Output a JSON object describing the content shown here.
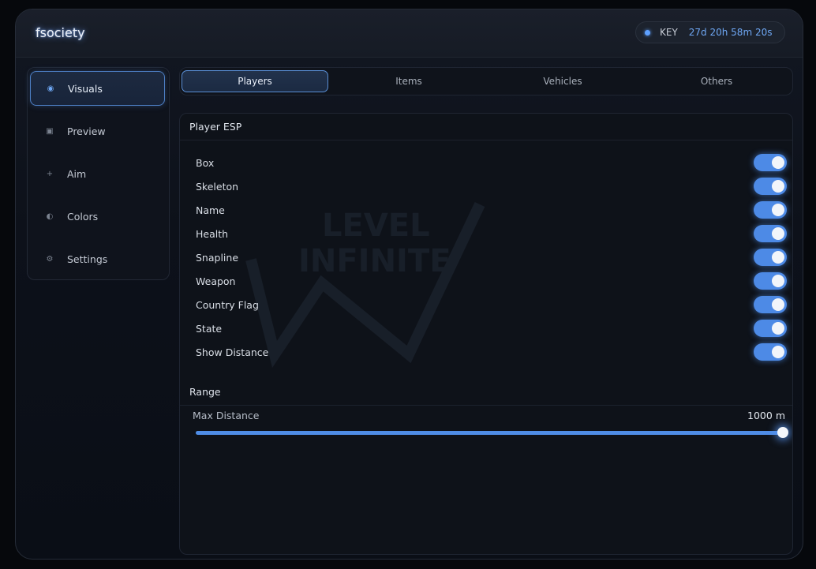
{
  "app": {
    "title": "fsociety"
  },
  "key": {
    "label": "KEY",
    "time": "27d 20h 58m 20s"
  },
  "sidebar": {
    "items": [
      {
        "label": "Visuals",
        "icon": "radio-dot-icon",
        "glyph": "◉",
        "active": true
      },
      {
        "label": "Preview",
        "icon": "square-icon",
        "glyph": "▣",
        "active": false
      },
      {
        "label": "Aim",
        "icon": "crosshair-icon",
        "glyph": "+",
        "active": false
      },
      {
        "label": "Colors",
        "icon": "half-circle-icon",
        "glyph": "◐",
        "active": false
      },
      {
        "label": "Settings",
        "icon": "gear-icon",
        "glyph": "⚙",
        "active": false
      }
    ]
  },
  "tabs": [
    {
      "label": "Players",
      "active": true
    },
    {
      "label": "Items",
      "active": false
    },
    {
      "label": "Vehicles",
      "active": false
    },
    {
      "label": "Others",
      "active": false
    }
  ],
  "player_esp": {
    "title": "Player ESP",
    "options": [
      {
        "label": "Box",
        "enabled": true
      },
      {
        "label": "Skeleton",
        "enabled": true
      },
      {
        "label": "Name",
        "enabled": true
      },
      {
        "label": "Health",
        "enabled": true
      },
      {
        "label": "Snapline",
        "enabled": true
      },
      {
        "label": "Weapon",
        "enabled": true
      },
      {
        "label": "Country Flag",
        "enabled": true
      },
      {
        "label": "State",
        "enabled": true
      },
      {
        "label": "Show Distance",
        "enabled": true
      }
    ]
  },
  "range": {
    "title": "Range",
    "max_distance_label": "Max Distance",
    "max_distance_value": "1000 m",
    "slider_fraction": 1.0
  },
  "watermark": {
    "line1": "LEVEL",
    "line2": "INFINITE"
  },
  "colors": {
    "accent": "#4d8ae6",
    "background": "#0e1219"
  }
}
